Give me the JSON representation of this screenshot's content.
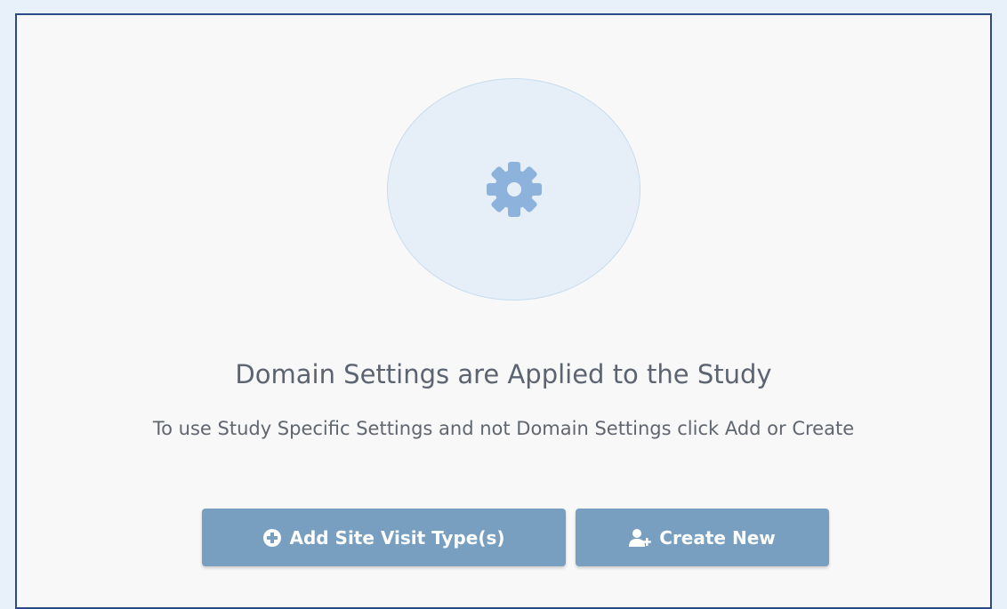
{
  "empty_state": {
    "title": "Domain Settings are Applied to the Study",
    "subtitle": "To use Study Specific Settings and not Domain Settings click Add or Create",
    "icon": "gear-icon"
  },
  "actions": {
    "add_label": "Add Site Visit Type(s)",
    "add_icon": "plus-circle-icon",
    "create_label": "Create New",
    "create_icon": "user-plus-icon"
  },
  "colors": {
    "page_background": "#e8f1fa",
    "panel_background": "#f8f8f8",
    "panel_border": "#2e4a86",
    "button_background": "#789fc0",
    "gear_color": "#8db3dc",
    "text_color": "#5b6470"
  }
}
